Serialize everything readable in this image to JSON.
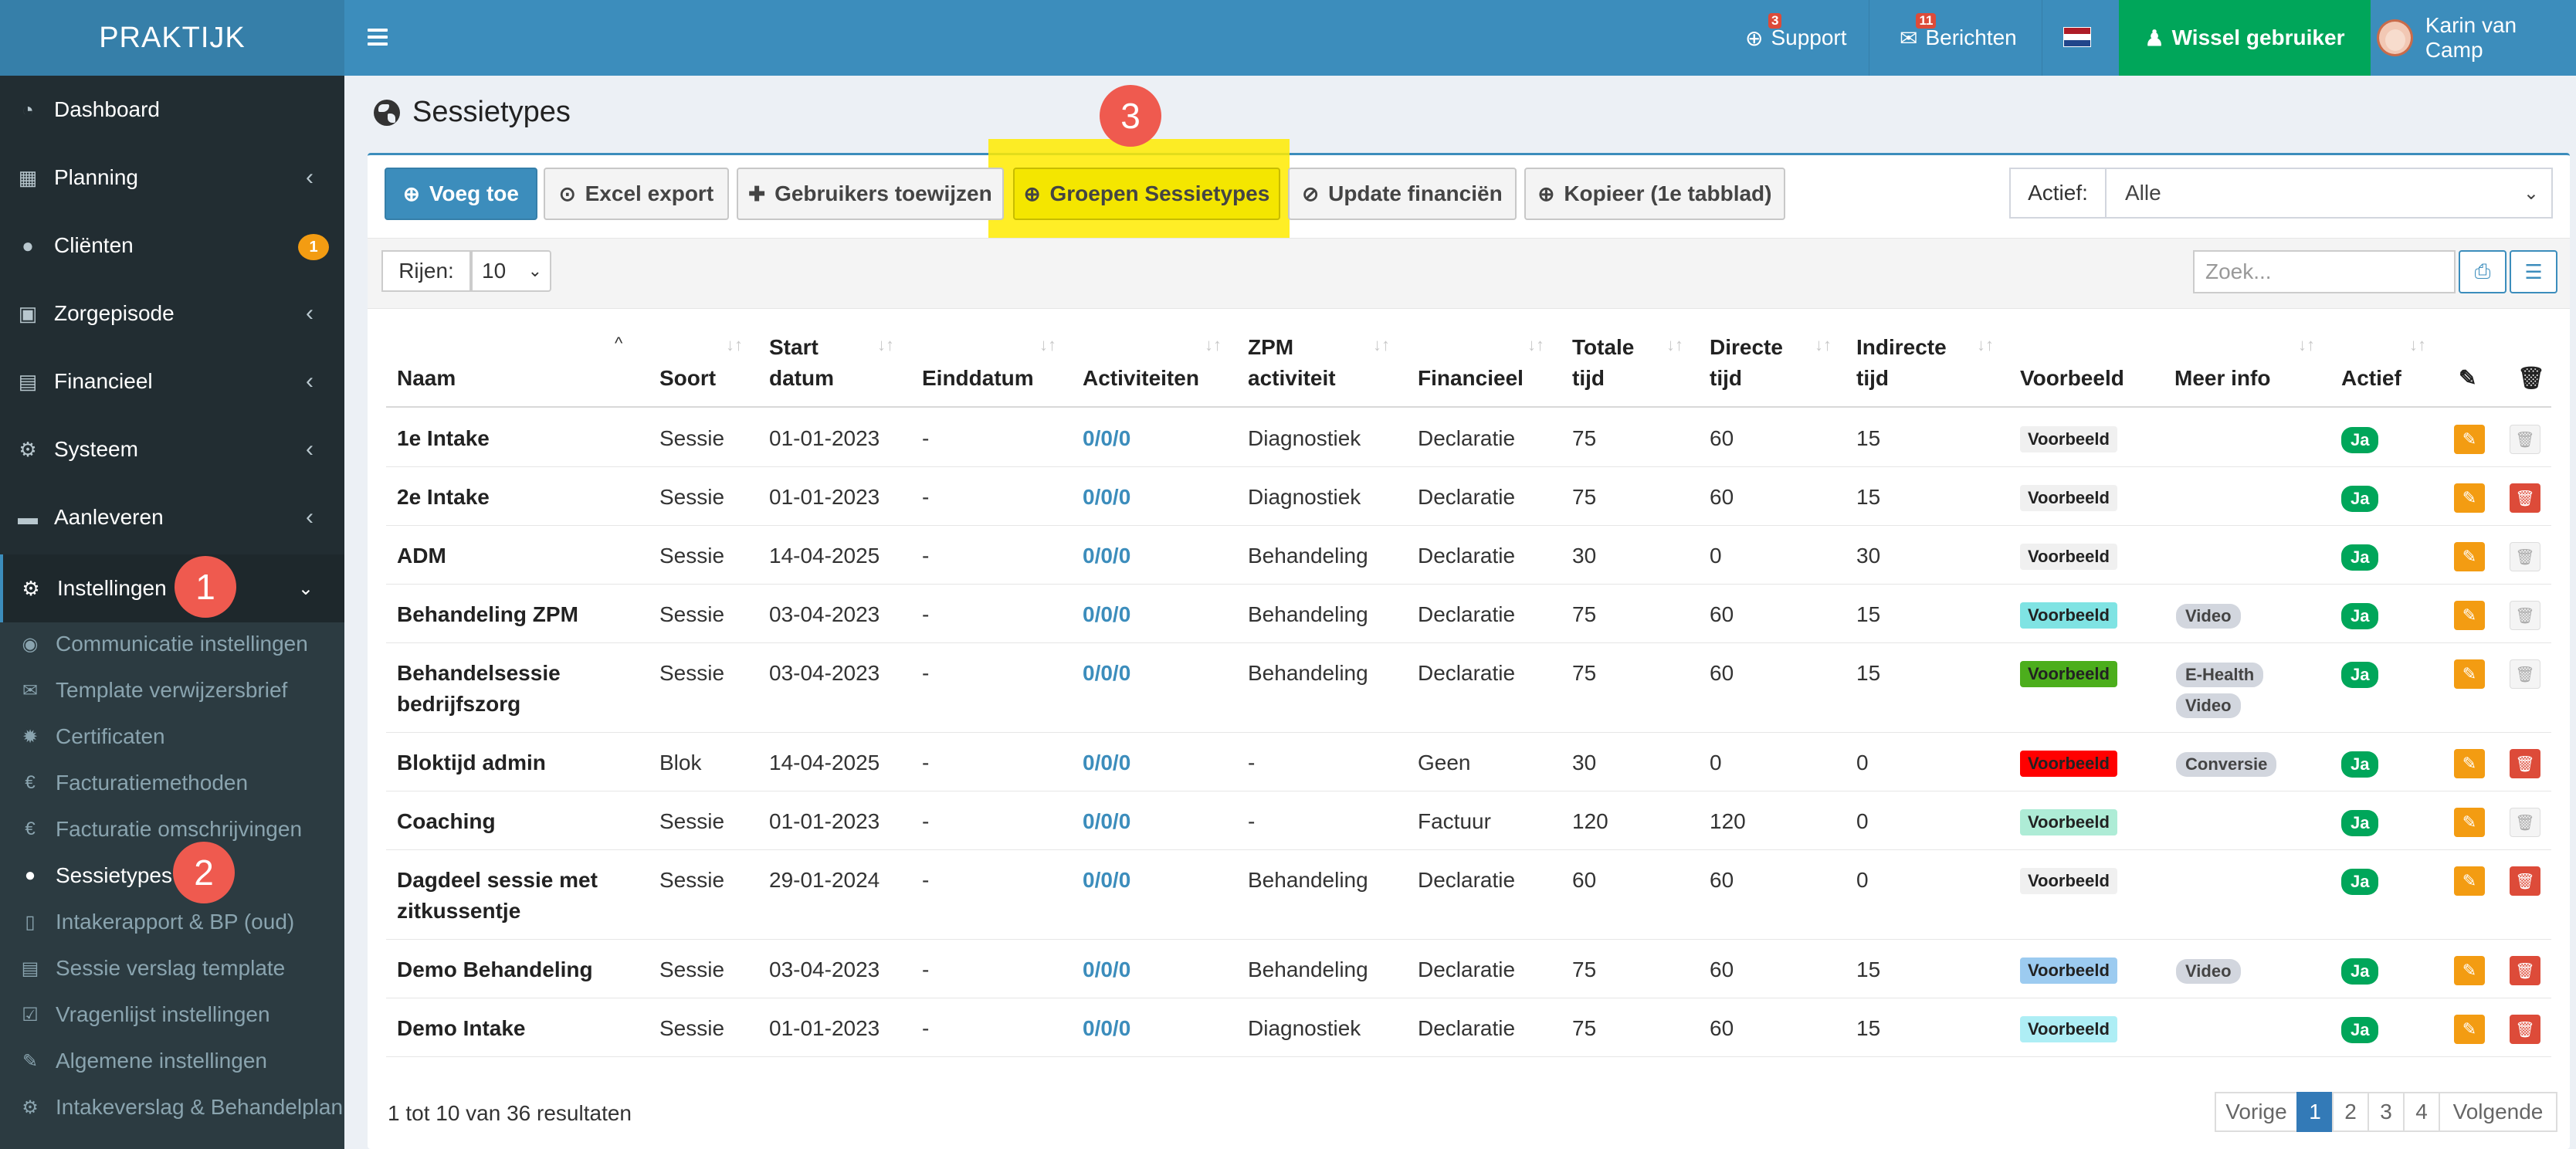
{
  "app": {
    "logo": "PRAKTIJK"
  },
  "topbar": {
    "support_label": "Support",
    "support_count": "3",
    "berichten_label": "Berichten",
    "berichten_count": "11",
    "wissel_label": "Wissel gebruiker",
    "user_name": "Karin van Camp",
    "colors": {
      "bar": "#3c8dbc",
      "wissel": "#00a65a"
    }
  },
  "sidebar": {
    "items": [
      {
        "label": "Dashboard",
        "icon": "dashboard-icon"
      },
      {
        "label": "Planning",
        "icon": "calendar-icon"
      },
      {
        "label": "Cliënten",
        "icon": "user-icon",
        "badge": "1"
      },
      {
        "label": "Zorgepisode",
        "icon": "medkit-icon"
      },
      {
        "label": "Financieel",
        "icon": "book-icon"
      },
      {
        "label": "Systeem",
        "icon": "cogs-icon"
      },
      {
        "label": "Aanleveren",
        "icon": "truck-icon"
      },
      {
        "label": "Instellingen",
        "icon": "gear-icon"
      }
    ],
    "submenu": [
      {
        "label": "Communicatie instellingen",
        "icon": "comments-icon"
      },
      {
        "label": "Template verwijzersbrief",
        "icon": "envelope-icon"
      },
      {
        "label": "Certificaten",
        "icon": "certificate-icon"
      },
      {
        "label": "Facturatiemethoden",
        "icon": "euro-icon"
      },
      {
        "label": "Facturatie omschrijvingen",
        "icon": "euro-icon"
      },
      {
        "label": "Sessietypes",
        "icon": "globe-icon"
      },
      {
        "label": "Intakerapport & BP (oud)",
        "icon": "file-icon"
      },
      {
        "label": "Sessie verslag template",
        "icon": "file-text-icon"
      },
      {
        "label": "Vragenlijst instellingen",
        "icon": "check-square-icon"
      },
      {
        "label": "Algemene instellingen",
        "icon": "wrench-icon"
      },
      {
        "label": "Intakeverslag & Behandelplan",
        "icon": "gear-icon"
      }
    ]
  },
  "markers": {
    "m1": "1",
    "m2": "2",
    "m3": "3"
  },
  "page": {
    "title": "Sessietypes"
  },
  "toolbar": {
    "voeg_toe": "Voeg toe",
    "excel": "Excel export",
    "gebruikers": "Gebruikers toewijzen",
    "groepen": "Groepen Sessietypes",
    "update": "Update financiën",
    "kopieer": "Kopieer (1e tabblad)",
    "actief_label": "Actief:",
    "actief_value": "Alle"
  },
  "list": {
    "rijen_label": "Rijen:",
    "rijen_value": "10",
    "search_placeholder": "Zoek..."
  },
  "table": {
    "headers": {
      "naam": "Naam",
      "soort": "Soort",
      "start1": "Start",
      "start2": "datum",
      "einddatum": "Einddatum",
      "activiteiten": "Activiteiten",
      "zpm1": "ZPM",
      "zpm2": "activiteit",
      "financieel": "Financieel",
      "totale1": "Totale",
      "totale2": "tijd",
      "directe1": "Directe",
      "directe2": "tijd",
      "indirecte1": "Indirecte",
      "indirecte2": "tijd",
      "voorbeeld": "Voorbeeld",
      "meerinfo": "Meer info",
      "actief": "Actief"
    },
    "rows": [
      {
        "naam1": "1e Intake",
        "soort": "Sessie",
        "start": "01-01-2023",
        "eind": "-",
        "act": "0/0/0",
        "zpm": "Diagnostiek",
        "fin": "Declaratie",
        "tot": "75",
        "dir": "60",
        "ind": "15",
        "voorbeeld": "Voorbeeld",
        "actief": "Ja"
      },
      {
        "naam1": "2e Intake",
        "soort": "Sessie",
        "start": "01-01-2023",
        "eind": "-",
        "act": "0/0/0",
        "zpm": "Diagnostiek",
        "fin": "Declaratie",
        "tot": "75",
        "dir": "60",
        "ind": "15",
        "voorbeeld": "Voorbeeld",
        "actief": "Ja"
      },
      {
        "naam1": "ADM",
        "soort": "Sessie",
        "start": "14-04-2025",
        "eind": "-",
        "act": "0/0/0",
        "zpm": "Behandeling",
        "fin": "Declaratie",
        "tot": "30",
        "dir": "0",
        "ind": "30",
        "voorbeeld": "Voorbeeld",
        "actief": "Ja"
      },
      {
        "naam1": "Behandeling ZPM",
        "soort": "Sessie",
        "start": "03-04-2023",
        "eind": "-",
        "act": "0/0/0",
        "zpm": "Behandeling",
        "fin": "Declaratie",
        "tot": "75",
        "dir": "60",
        "ind": "15",
        "voorbeeld": "Voorbeeld",
        "info1": "Video",
        "actief": "Ja"
      },
      {
        "naam1": "Behandelsessie",
        "naam2": "bedrijfszorg",
        "soort": "Sessie",
        "start": "03-04-2023",
        "eind": "-",
        "act": "0/0/0",
        "zpm": "Behandeling",
        "fin": "Declaratie",
        "tot": "75",
        "dir": "60",
        "ind": "15",
        "voorbeeld": "Voorbeeld",
        "info1": "E-Health",
        "info2": "Video",
        "actief": "Ja"
      },
      {
        "naam1": "Bloktijd admin",
        "soort": "Blok",
        "start": "14-04-2025",
        "eind": "-",
        "act": "0/0/0",
        "zpm": "-",
        "fin": "Geen",
        "tot": "30",
        "dir": "0",
        "ind": "0",
        "voorbeeld": "Voorbeeld",
        "info1": "Conversie",
        "actief": "Ja"
      },
      {
        "naam1": "Coaching",
        "soort": "Sessie",
        "start": "01-01-2023",
        "eind": "-",
        "act": "0/0/0",
        "zpm": "-",
        "fin": "Factuur",
        "tot": "120",
        "dir": "120",
        "ind": "0",
        "voorbeeld": "Voorbeeld",
        "actief": "Ja"
      },
      {
        "naam1": "Dagdeel sessie met",
        "naam2": "zitkussentje",
        "soort": "Sessie",
        "start": "29-01-2024",
        "eind": "-",
        "act": "0/0/0",
        "zpm": "Behandeling",
        "fin": "Declaratie",
        "tot": "60",
        "dir": "60",
        "ind": "0",
        "voorbeeld": "Voorbeeld",
        "actief": "Ja"
      },
      {
        "naam1": "Demo Behandeling",
        "soort": "Sessie",
        "start": "03-04-2023",
        "eind": "-",
        "act": "0/0/0",
        "zpm": "Behandeling",
        "fin": "Declaratie",
        "tot": "75",
        "dir": "60",
        "ind": "15",
        "voorbeeld": "Voorbeeld",
        "info1": "Video",
        "actief": "Ja"
      },
      {
        "naam1": "Demo Intake",
        "soort": "Sessie",
        "start": "01-01-2023",
        "eind": "-",
        "act": "0/0/0",
        "zpm": "Diagnostiek",
        "fin": "Declaratie",
        "tot": "75",
        "dir": "60",
        "ind": "15",
        "voorbeeld": "Voorbeeld",
        "actief": "Ja"
      }
    ]
  },
  "footer": {
    "results": "1 tot 10 van 36 resultaten",
    "vorige": "Vorige",
    "p1": "1",
    "p2": "2",
    "p3": "3",
    "p4": "4",
    "volgende": "Volgende"
  }
}
